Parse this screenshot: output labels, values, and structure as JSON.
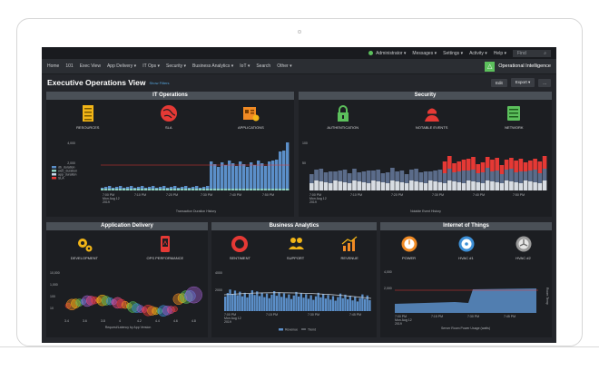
{
  "topbar": {
    "admin": "Administrator ▾",
    "messages": "Messages ▾",
    "settings": "Settings ▾",
    "activity": "Activity ▾",
    "help": "Help ▾",
    "find": "Find"
  },
  "nav": {
    "items": [
      "Home",
      "101",
      "Exec View",
      "App Delivery ▾",
      "IT Ops ▾",
      "Security ▾",
      "Business Analytics ▾",
      "IoT ▾",
      "Search",
      "Other ▾"
    ],
    "app_name": "Operational Intelligence"
  },
  "page": {
    "title": "Executive Operations View",
    "show_filters": "Show Filters",
    "edit": "Edit",
    "export": "Export ▾",
    "more": "..."
  },
  "panels": {
    "it_ops": {
      "title": "IT Operations",
      "icons": [
        {
          "label": "RESOURCES",
          "icon": "server-icon",
          "color": "#f2b517"
        },
        {
          "label": "SLA",
          "icon": "globe-icon",
          "color": "#e53935"
        },
        {
          "label": "APPLICATIONS",
          "icon": "app-window-icon",
          "color": "#f08a24"
        }
      ],
      "caption": "Transaction Duration History",
      "y_ticks": [
        "4,000",
        "2,000"
      ],
      "x_ticks": [
        "7:00 PM\nMon Aug 12\n2019",
        "7:10 PM",
        "7:20 PM",
        "7:30 PM",
        "7:40 PM",
        "7:50 PM"
      ],
      "legend": [
        "db_duration",
        "web_duration",
        "app_duration",
        "SLA"
      ]
    },
    "security": {
      "title": "Security",
      "icons": [
        {
          "label": "AUTHENTICATION",
          "icon": "lock-icon",
          "color": "#5cc05c"
        },
        {
          "label": "NOTABLE EVENTS",
          "icon": "hacker-icon",
          "color": "#e53935"
        },
        {
          "label": "NETWORK",
          "icon": "network-device-icon",
          "color": "#5cc05c"
        }
      ],
      "caption": "Notable Event History",
      "y_ticks": [
        "100",
        "50"
      ],
      "x_ticks": [
        "7:00 PM\nMon Aug 12\n2019",
        "7:10 PM",
        "7:20 PM",
        "7:30 PM",
        "7:40 PM",
        "7:50 PM"
      ]
    },
    "app_delivery": {
      "title": "Application Delivery",
      "icons": [
        {
          "label": "DEVELOPMENT",
          "icon": "gears-icon",
          "color": "#f2b517"
        },
        {
          "label": "OPS PERFORMANCE",
          "icon": "mobile-performance-icon",
          "color": "#e53935"
        }
      ],
      "caption": "Request/Latency by App Version",
      "y_ticks": [
        "10,000",
        "1,000",
        "100",
        "10"
      ],
      "x_ticks": [
        "3.4",
        "3.6",
        "3.8",
        "4",
        "4.2",
        "4.4",
        "4.6",
        "4.8"
      ]
    },
    "business": {
      "title": "Business Analytics",
      "icons": [
        {
          "label": "SENTIMENT",
          "icon": "ring-icon",
          "color": "#e53935"
        },
        {
          "label": "SUPPORT",
          "icon": "people-icon",
          "color": "#f2b517"
        },
        {
          "label": "REVENUE",
          "icon": "bar-growth-icon",
          "color": "#f08a24"
        }
      ],
      "y_ticks": [
        "4000",
        "2000"
      ],
      "x_ticks": [
        "7:00 PM\nMon Aug 12\n2019",
        "7:15 PM",
        "7:30 PM",
        "7:45 PM"
      ],
      "legend": [
        "Revenue",
        "Trend"
      ]
    },
    "iot": {
      "title": "Internet of Things",
      "icons": [
        {
          "label": "POWER",
          "icon": "power-gauge-icon",
          "color": "#f08a24"
        },
        {
          "label": "HVAC #1",
          "icon": "gauge-icon",
          "color": "#3d8fd6"
        },
        {
          "label": "HVAC #2",
          "icon": "fan-gauge-icon",
          "color": "#9a9a9a"
        }
      ],
      "caption": "Server Room Power Usage (watts)",
      "y_ticks": [
        "4,000",
        "2,000"
      ],
      "x_ticks": [
        "7:00 PM\nMon Aug 12\n2019",
        "7:15 PM",
        "7:30 PM",
        "7:45 PM"
      ],
      "y_label": "Room Temp"
    }
  },
  "colors": {
    "accent_green": "#5cc05c",
    "bar_blue": "#5b8fc9",
    "sla_red": "#e53935",
    "dark_bg": "#24262b"
  }
}
